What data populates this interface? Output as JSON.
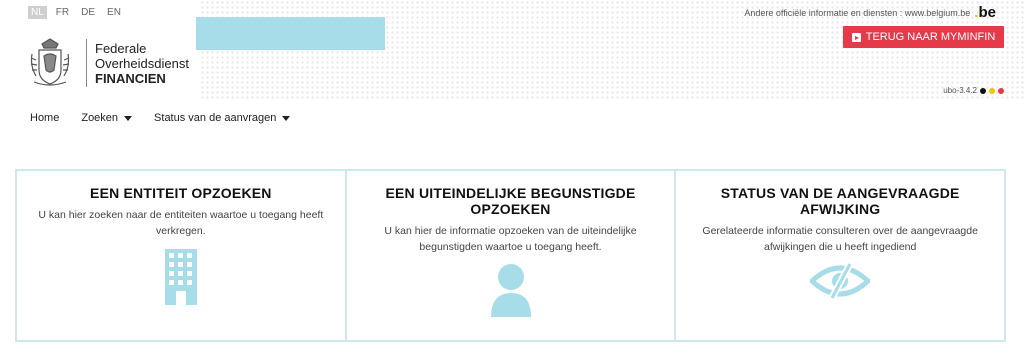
{
  "languages": [
    {
      "label": "NL",
      "active": true
    },
    {
      "label": "FR",
      "active": false
    },
    {
      "label": "DE",
      "active": false
    },
    {
      "label": "EN",
      "active": false
    }
  ],
  "header": {
    "other_info": "Andere officiële informatie en diensten : www.belgium.be",
    "be_logo": "be",
    "back_button": "TERUG NAAR MYMINFIN",
    "logo_line1": "Federale",
    "logo_line2": "Overheidsdienst",
    "logo_line3": "FINANCIEN",
    "version": "ubo-3.4.2"
  },
  "nav": [
    {
      "label": "Home",
      "dropdown": false
    },
    {
      "label": "Zoeken",
      "dropdown": true
    },
    {
      "label": "Status van de aanvragen",
      "dropdown": true
    }
  ],
  "cards": [
    {
      "title": "EEN ENTITEIT OPZOEKEN",
      "text": "U kan hier zoeken naar de entiteiten waartoe u toegang heeft verkregen.",
      "icon": "building-icon"
    },
    {
      "title": "EEN UITEINDELIJKE BEGUNSTIGDE OPZOEKEN",
      "text": "U kan hier de informatie opzoeken van de uiteindelijke begunstigden waartoe u toegang heeft.",
      "icon": "person-icon"
    },
    {
      "title": "STATUS VAN DE AANGEVRAAGDE AFWIJKING",
      "text": "Gerelateerde informatie consulteren over de aangevraagde afwijkingen die u heeft ingediend",
      "icon": "eye-slash-icon"
    }
  ],
  "colors": {
    "accent_red": "#e53a4a",
    "icon_blue": "#a6dde9",
    "banner": "#a6dde9",
    "flag_black": "#111111",
    "flag_yellow": "#f2c500",
    "flag_red": "#e53a4a"
  }
}
